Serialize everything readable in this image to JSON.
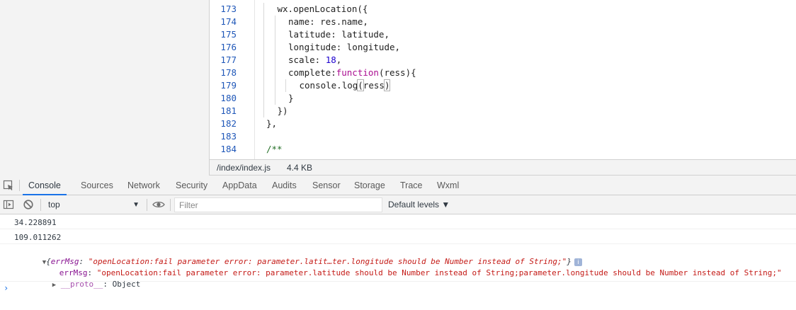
{
  "editor": {
    "lines": [
      {
        "num": "173",
        "indent": 1,
        "parts": [
          {
            "t": "wx.openLocation({",
            "c": ""
          }
        ]
      },
      {
        "num": "174",
        "indent": 2,
        "parts": [
          {
            "t": "name: res.name,",
            "c": ""
          }
        ]
      },
      {
        "num": "175",
        "indent": 2,
        "parts": [
          {
            "t": "latitude: latitude,",
            "c": ""
          }
        ]
      },
      {
        "num": "176",
        "indent": 2,
        "parts": [
          {
            "t": "longitude: longitude,",
            "c": ""
          }
        ]
      },
      {
        "num": "177",
        "indent": 2,
        "parts": [
          {
            "t": "scale: ",
            "c": ""
          },
          {
            "t": "18",
            "c": "num"
          },
          {
            "t": ",",
            "c": ""
          }
        ]
      },
      {
        "num": "178",
        "indent": 2,
        "parts": [
          {
            "t": "complete:",
            "c": ""
          },
          {
            "t": "function",
            "c": "kw"
          },
          {
            "t": "(ress){",
            "c": ""
          }
        ]
      },
      {
        "num": "179",
        "indent": 3,
        "parts": [
          {
            "t": "console.log",
            "c": ""
          },
          {
            "t": "(",
            "c": "bracket-hl"
          },
          {
            "t": "ress",
            "c": ""
          },
          {
            "t": ")",
            "c": "bracket-hl"
          }
        ]
      },
      {
        "num": "180",
        "indent": 2,
        "parts": [
          {
            "t": "}",
            "c": ""
          }
        ]
      },
      {
        "num": "181",
        "indent": 1,
        "parts": [
          {
            "t": "})",
            "c": ""
          }
        ]
      },
      {
        "num": "182",
        "indent": 0,
        "parts": [
          {
            "t": "},",
            "c": ""
          }
        ]
      },
      {
        "num": "183",
        "indent": 0,
        "parts": [
          {
            "t": "",
            "c": ""
          }
        ]
      },
      {
        "num": "184",
        "indent": 0,
        "parts": [
          {
            "t": "/**",
            "c": "cm"
          }
        ]
      }
    ]
  },
  "status": {
    "file": "/index/index.js",
    "size": "4.4 KB"
  },
  "tabs": [
    {
      "label": "Console",
      "active": true
    },
    {
      "label": "Sources",
      "active": false
    },
    {
      "label": "Network",
      "active": false
    },
    {
      "label": "Security",
      "active": false
    },
    {
      "label": "AppData",
      "active": false
    },
    {
      "label": "Audits",
      "active": false
    },
    {
      "label": "Sensor",
      "active": false
    },
    {
      "label": "Storage",
      "active": false
    },
    {
      "label": "Trace",
      "active": false
    },
    {
      "label": "Wxml",
      "active": false
    }
  ],
  "filterbar": {
    "context": "top",
    "filter_placeholder": "Filter",
    "levels": "Default levels ▼"
  },
  "console": {
    "messages": [
      "34.228891",
      "109.011262"
    ],
    "object": {
      "summary_key": "errMsg",
      "summary_value": "\"openLocation:fail parameter error: parameter.latit…ter.longitude should be Number instead of String;\"",
      "prop_key": "errMsg",
      "prop_value": "\"openLocation:fail parameter error: parameter.latitude should be Number instead of String;parameter.longitude should be Number instead of String;\"",
      "proto_key": "__proto__",
      "proto_value": "Object",
      "info_badge": "i"
    },
    "prompt": "›"
  },
  "colors": {
    "accent": "#1a73e8",
    "string": "#c41a16",
    "property": "#881391",
    "line_number": "#1f57b8"
  }
}
